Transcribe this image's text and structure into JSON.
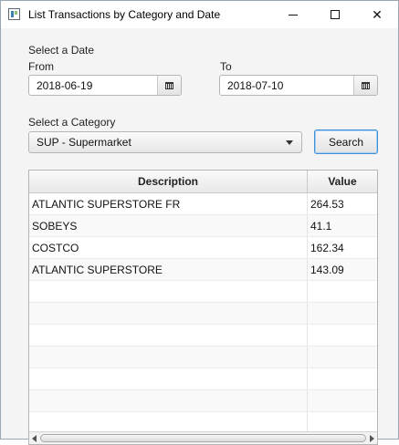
{
  "window": {
    "title": "List Transactions by Category and Date"
  },
  "date_section": {
    "heading": "Select a Date",
    "from_label": "From",
    "from_value": "2018-06-19",
    "to_label": "To",
    "to_value": "2018-07-10"
  },
  "category_section": {
    "label": "Select a Category",
    "selected": "SUP - Supermarket",
    "search_label": "Search"
  },
  "table": {
    "columns": [
      "Description",
      "Value"
    ],
    "rows": [
      {
        "description": "ATLANTIC SUPERSTORE FR",
        "value": "264.53"
      },
      {
        "description": "SOBEYS",
        "value": "41.1"
      },
      {
        "description": "COSTCO",
        "value": "162.34"
      },
      {
        "description": "ATLANTIC SUPERSTORE",
        "value": "143.09"
      },
      {
        "description": "",
        "value": ""
      },
      {
        "description": "",
        "value": ""
      },
      {
        "description": "",
        "value": ""
      },
      {
        "description": "",
        "value": ""
      },
      {
        "description": "",
        "value": ""
      },
      {
        "description": "",
        "value": ""
      },
      {
        "description": "",
        "value": ""
      }
    ]
  },
  "icons": {
    "app": "app-window-icon",
    "calendar": "calendar-icon",
    "dropdown": "chevron-down-icon"
  }
}
